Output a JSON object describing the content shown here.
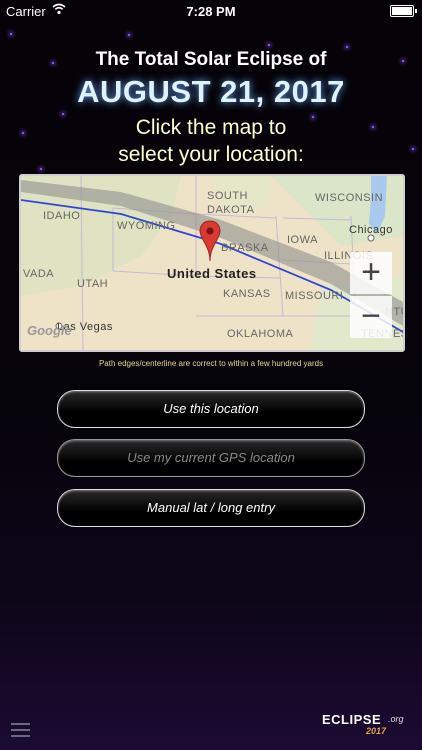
{
  "status_bar": {
    "carrier": "Carrier",
    "time": "7:28 PM"
  },
  "header": {
    "line1": "The Total Solar Eclipse of",
    "line2": "AUGUST 21, 2017",
    "instruction_line1": "Click the map to",
    "instruction_line2": "select your location:"
  },
  "map": {
    "labels": {
      "idaho": "IDAHO",
      "wyoming": "WYOMING",
      "south_dakota_1": "SOUTH",
      "south_dakota_2": "DAKOTA",
      "wisconsin": "WISCONSIN",
      "nebraska": "BRASKA",
      "iowa": "IOWA",
      "chicago": "Chicago",
      "illinois": "ILLINOIS",
      "nevada": "VADA",
      "utah": "UTAH",
      "country": "United States",
      "kansas": "KANSAS",
      "missouri": "MISSOURI",
      "las_vegas": "Las Vegas",
      "oklahoma": "OKLAHOMA",
      "tennessee": "TENNESSE",
      "ky_fragment": "NTU"
    },
    "zoom_in": "+",
    "zoom_out": "−",
    "attribution": "Google"
  },
  "note": "Path edges/centerline are correct to within a few hundred yards",
  "buttons": {
    "use_location": "Use this location",
    "use_gps": "Use my current GPS location",
    "manual_entry": "Manual lat / long entry"
  },
  "logo": {
    "word": "ECLIPSE",
    "suffix": ".org",
    "year": "2017"
  },
  "colors": {
    "pin": "#d83a32",
    "centerline": "#2f45d8",
    "path_band": "#8f8f8f",
    "instruction_text": "#ffffcc"
  }
}
